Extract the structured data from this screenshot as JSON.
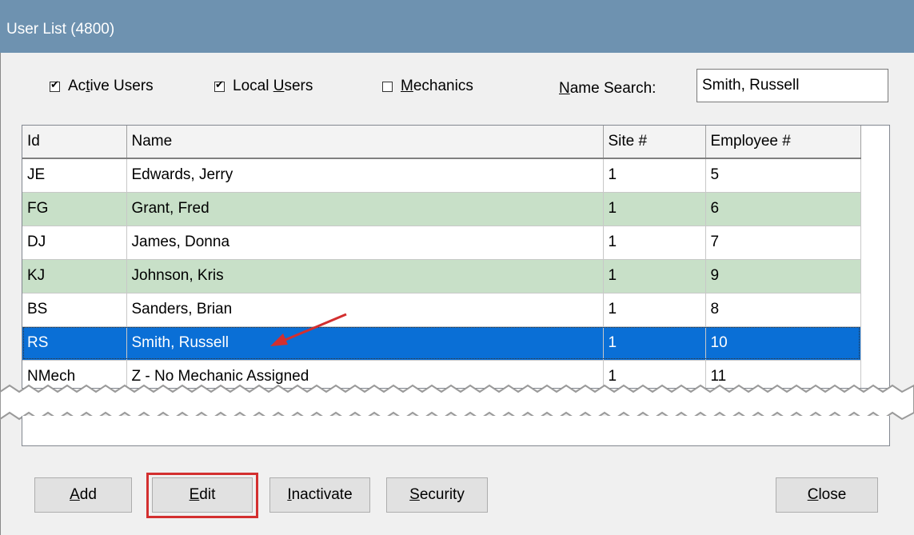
{
  "window": {
    "title": "User List (4800)"
  },
  "filters": {
    "active_users": {
      "prefix": "Ac",
      "key": "t",
      "suffix": "ive Users",
      "checked": true
    },
    "local_users": {
      "prefix": "Local ",
      "key": "U",
      "suffix": "sers",
      "checked": true
    },
    "mechanics": {
      "prefix": "",
      "key": "M",
      "suffix": "echanics",
      "checked": false
    }
  },
  "search": {
    "label_key": "N",
    "label_rest": "ame Search:",
    "value": "Smith, Russell"
  },
  "table": {
    "columns": [
      "Id",
      "Name",
      "Site #",
      "Employee #"
    ],
    "rows": [
      {
        "id": "JE",
        "name": "Edwards, Jerry",
        "site": "1",
        "employee": "5"
      },
      {
        "id": "FG",
        "name": "Grant, Fred",
        "site": "1",
        "employee": "6"
      },
      {
        "id": "DJ",
        "name": "James, Donna",
        "site": "1",
        "employee": "7"
      },
      {
        "id": "KJ",
        "name": "Johnson, Kris",
        "site": "1",
        "employee": "9"
      },
      {
        "id": "BS",
        "name": "Sanders, Brian",
        "site": "1",
        "employee": "8"
      },
      {
        "id": "RS",
        "name": "Smith, Russell",
        "site": "1",
        "employee": "10"
      },
      {
        "id": "NMech",
        "name": "Z - No Mechanic Assigned",
        "site": "1",
        "employee": "11"
      }
    ],
    "selected_row": 5
  },
  "buttons": {
    "add": {
      "key": "A",
      "rest": "dd"
    },
    "edit": {
      "key": "E",
      "rest": "dit"
    },
    "inactivate": {
      "key": "I",
      "rest": "nactivate"
    },
    "security": {
      "key": "S",
      "rest": "ecurity"
    },
    "close": {
      "key": "C",
      "rest": "lose"
    }
  },
  "colors": {
    "titlebar": "#6e92b0",
    "row_alt": "#c8e0c8",
    "row_selected": "#0a6fd6",
    "highlight_border": "#d32f2f",
    "annotation_arrow": "#d32f2f"
  }
}
